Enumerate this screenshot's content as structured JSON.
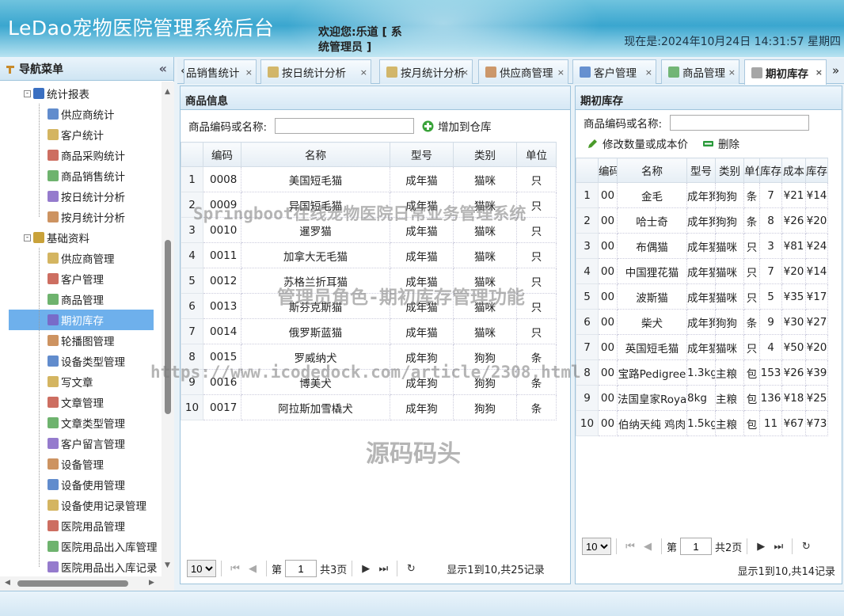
{
  "header": {
    "title": "LeDao宠物医院管理系统后台",
    "welcome": "欢迎您:乐道 [ 系统管理员 ]",
    "datetime": "现在是:2024年10月24日 14:31:57 星期四"
  },
  "sidebar": {
    "title": "导航菜单",
    "collapse": "«",
    "groups": [
      {
        "label": "统计报表",
        "items": [
          "供应商统计",
          "客户统计",
          "商品采购统计",
          "商品销售统计",
          "按日统计分析",
          "按月统计分析"
        ]
      },
      {
        "label": "基础资料",
        "items": [
          "供应商管理",
          "客户管理",
          "商品管理",
          "期初库存",
          "轮播图管理",
          "设备类型管理",
          "写文章",
          "文章管理",
          "文章类型管理",
          "客户留言管理",
          "设备管理",
          "设备使用管理",
          "设备使用记录管理",
          "医院用品管理",
          "医院用品出入库管理",
          "医院用品出入库记录"
        ]
      }
    ],
    "selected": "期初库存"
  },
  "tabs": {
    "scroll_left": "«",
    "scroll_right": "»",
    "items": [
      {
        "label": "品销售统计",
        "active": false
      },
      {
        "label": "按日统计分析",
        "active": false
      },
      {
        "label": "按月统计分析",
        "active": false
      },
      {
        "label": "供应商管理",
        "active": false
      },
      {
        "label": "客户管理",
        "active": false
      },
      {
        "label": "商品管理",
        "active": false
      },
      {
        "label": "期初库存",
        "active": true
      }
    ],
    "close": "×"
  },
  "left_panel": {
    "title": "商品信息",
    "search_label": "商品编码或名称:",
    "search_value": "",
    "add_button": "增加到仓库",
    "columns": [
      "编码",
      "名称",
      "型号",
      "类别",
      "单位"
    ],
    "rows": [
      [
        "0008",
        "美国短毛猫",
        "成年猫",
        "猫咪",
        "只"
      ],
      [
        "0009",
        "异国短毛猫",
        "成年猫",
        "猫咪",
        "只"
      ],
      [
        "0010",
        "暹罗猫",
        "成年猫",
        "猫咪",
        "只"
      ],
      [
        "0011",
        "加拿大无毛猫",
        "成年猫",
        "猫咪",
        "只"
      ],
      [
        "0012",
        "苏格兰折耳猫",
        "成年猫",
        "猫咪",
        "只"
      ],
      [
        "0013",
        "斯芬克斯猫",
        "成年猫",
        "猫咪",
        "只"
      ],
      [
        "0014",
        "俄罗斯蓝猫",
        "成年猫",
        "猫咪",
        "只"
      ],
      [
        "0015",
        "罗威纳犬",
        "成年狗",
        "狗狗",
        "条"
      ],
      [
        "0016",
        "博美犬",
        "成年狗",
        "狗狗",
        "条"
      ],
      [
        "0017",
        "阿拉斯加雪橇犬",
        "成年狗",
        "狗狗",
        "条"
      ]
    ],
    "pager": {
      "page_size": "10",
      "page_prefix": "第",
      "page": "1",
      "page_total": "共3页",
      "summary": "显示1到10,共25记录"
    }
  },
  "right_panel": {
    "title": "期初库存",
    "search_label": "商品编码或名称:",
    "search_value": "",
    "edit_button": "修改数量或成本价",
    "delete_button": "删除",
    "columns": [
      "编码",
      "名称",
      "型号",
      "类别",
      "单位",
      "库存",
      "成本",
      "库存"
    ],
    "rows": [
      [
        "00",
        "金毛",
        "成年狗",
        "狗狗",
        "条",
        "7",
        "¥21",
        "¥14"
      ],
      [
        "00",
        "哈士奇",
        "成年狗",
        "狗狗",
        "条",
        "8",
        "¥26",
        "¥20"
      ],
      [
        "00",
        "布偶猫",
        "成年猫",
        "猫咪",
        "只",
        "3",
        "¥81",
        "¥24"
      ],
      [
        "00",
        "中国狸花猫",
        "成年猫",
        "猫咪",
        "只",
        "7",
        "¥20",
        "¥14"
      ],
      [
        "00",
        "波斯猫",
        "成年猫",
        "猫咪",
        "只",
        "5",
        "¥35",
        "¥17"
      ],
      [
        "00",
        "柴犬",
        "成年狗",
        "狗狗",
        "条",
        "9",
        "¥30",
        "¥27"
      ],
      [
        "00",
        "英国短毛猫",
        "成年猫",
        "猫咪",
        "只",
        "4",
        "¥50",
        "¥20"
      ],
      [
        "00",
        "宝路Pedigree",
        "1.3kg",
        "主粮",
        "包",
        "153",
        "¥26",
        "¥39"
      ],
      [
        "00",
        "法国皇家Royal",
        "8kg",
        "主粮",
        "包",
        "136",
        "¥18",
        "¥25"
      ],
      [
        "00",
        "伯纳天纯 鸡肉",
        "1.5kg",
        "主粮",
        "包",
        "11",
        "¥67",
        "¥73"
      ]
    ],
    "pager": {
      "page_size": "10",
      "page_prefix": "第",
      "page": "1",
      "page_total": "共2页",
      "summary": "显示1到10,共14记录"
    }
  },
  "watermarks": {
    "line1": "Springboot在线宠物医院日常业务管理系统",
    "line2": "管理员角色-期初库存管理功能",
    "line3": "https://www.icodedock.com/article/2308.html",
    "line4": "源码码头"
  },
  "colors": {
    "header_top": "#6fc3de",
    "selected_row": "#6eb0ec",
    "border": "#9fc4dc"
  }
}
